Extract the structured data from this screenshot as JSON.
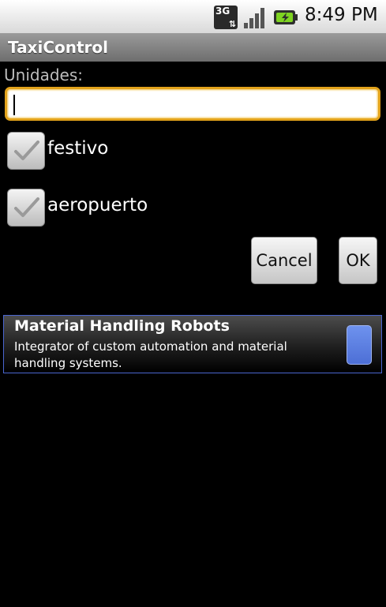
{
  "status_bar": {
    "network_label": "3G",
    "time": "8:49 PM",
    "icons": [
      "3g-icon",
      "signal-icon",
      "battery-charging-icon"
    ]
  },
  "app": {
    "title": "TaxiControl"
  },
  "form": {
    "units_label": "Unidades:",
    "units_value": "",
    "checkboxes": [
      {
        "label": "festivo",
        "checked": false
      },
      {
        "label": "aeropuerto",
        "checked": false
      }
    ],
    "cancel_label": "Cancel",
    "ok_label": "OK"
  },
  "ad": {
    "title": "Material Handling Robots",
    "description": "Integrator of custom automation and material handling systems."
  },
  "colors": {
    "focus_border": "#e2a21b",
    "ad_border": "#4a66d0",
    "ad_icon": "#5c80e2"
  }
}
